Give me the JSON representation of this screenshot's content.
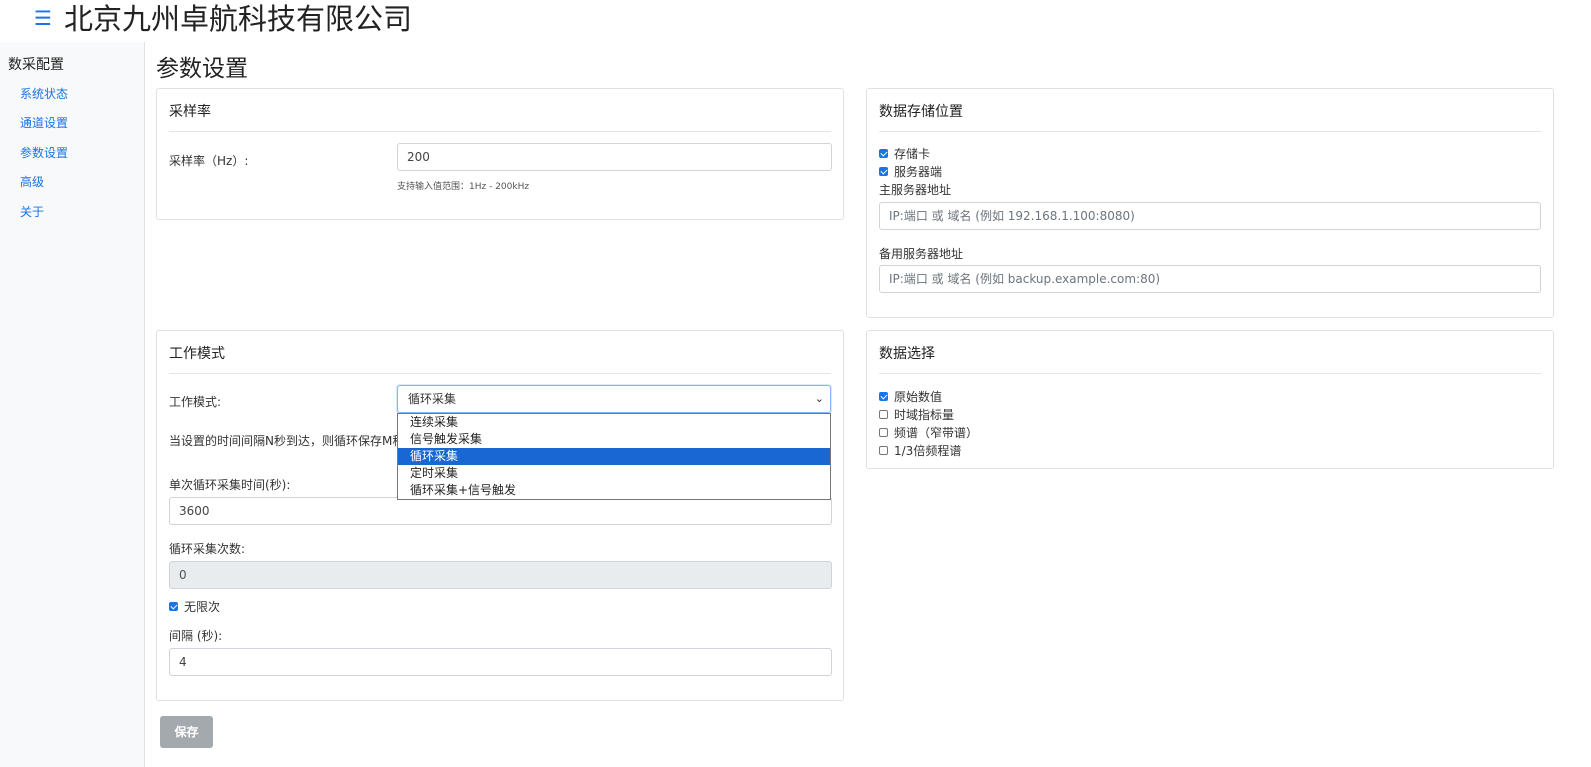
{
  "header": {
    "title": "北京九州卓航科技有限公司",
    "menu_icon": "hamburger-icon"
  },
  "sidebar": {
    "heading": "数采配置",
    "items": [
      {
        "label": "系统状态"
      },
      {
        "label": "通道设置"
      },
      {
        "label": "参数设置"
      },
      {
        "label": "高级"
      },
      {
        "label": "关于"
      }
    ]
  },
  "page": {
    "title": "参数设置"
  },
  "sampling": {
    "title": "采样率",
    "label": "采样率（Hz）:",
    "value": "200",
    "hint": "支持输入值范围：1Hz - 200kHz"
  },
  "storage": {
    "title": "数据存储位置",
    "options": [
      {
        "label": "存储卡",
        "checked": true
      },
      {
        "label": "服务器端",
        "checked": true
      }
    ],
    "primary_label": "主服务器地址",
    "primary_placeholder": "IP:端口 或 域名 (例如 192.168.1.100:8080)",
    "backup_label": "备用服务器地址",
    "backup_placeholder": "IP:端口 或 域名 (例如 backup.example.com:80)"
  },
  "workmode": {
    "title": "工作模式",
    "label": "工作模式:",
    "selected": "循环采集",
    "options": [
      "连续采集",
      "信号触发采集",
      "循环采集",
      "定时采集",
      "循环采集+信号触发"
    ],
    "description": "当设置的时间间隔N秒到达，则循环保存M秒",
    "single_time_label": "单次循环采集时间(秒):",
    "single_time_value": "3600",
    "count_label": "循环采集次数:",
    "count_value": "0",
    "unlimited_label": "无限次",
    "interval_label": "间隔 (秒):",
    "interval_value": "4"
  },
  "dataselect": {
    "title": "数据选择",
    "options": [
      {
        "label": "原始数值",
        "checked": true
      },
      {
        "label": "时域指标量",
        "checked": false
      },
      {
        "label": "频谱（窄带谱）",
        "checked": false
      },
      {
        "label": "1/3倍频程谱",
        "checked": false
      }
    ]
  },
  "save_button": "保存",
  "colors": {
    "accent": "#1a73e8",
    "selected_option": "#1967d2",
    "disabled_button": "#a4a9ae"
  }
}
